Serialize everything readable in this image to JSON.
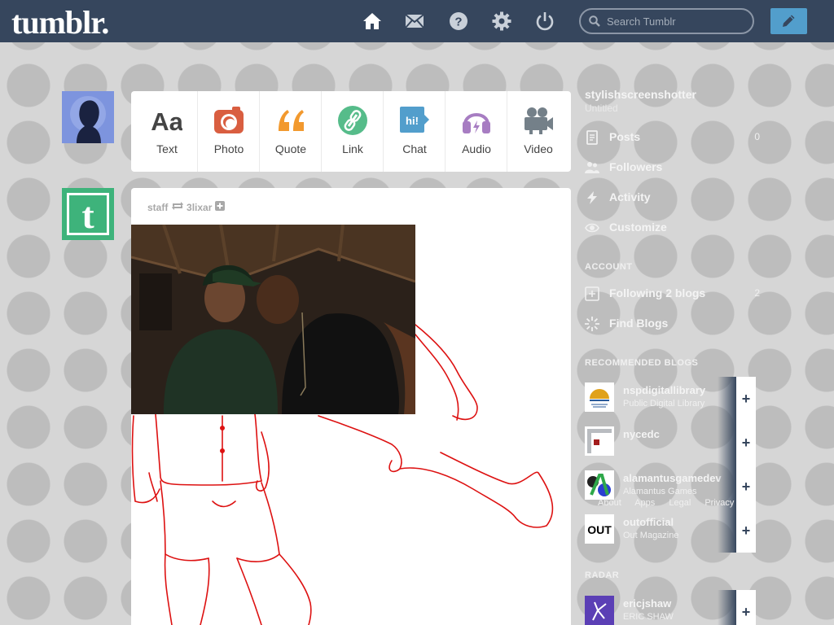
{
  "header": {
    "logo": "tumblr.",
    "search_placeholder": "Search Tumblr",
    "nav": [
      "home-icon",
      "mail-icon",
      "help-icon",
      "settings-icon",
      "power-icon"
    ]
  },
  "post_types": [
    {
      "label": "Text",
      "icon": "text-icon",
      "glyph": "Aa",
      "color": "#444444"
    },
    {
      "label": "Photo",
      "icon": "camera-icon",
      "color": "#d95e40"
    },
    {
      "label": "Quote",
      "icon": "quote-icon",
      "glyph": "“",
      "color": "#f2992e"
    },
    {
      "label": "Link",
      "icon": "link-icon",
      "color": "#56bc8a"
    },
    {
      "label": "Chat",
      "icon": "chat-icon",
      "glyph": "hi!",
      "color": "#529ecc"
    },
    {
      "label": "Audio",
      "icon": "headphones-icon",
      "color": "#a77dc2"
    },
    {
      "label": "Video",
      "icon": "video-camera-icon",
      "color": "#748089"
    }
  ],
  "post": {
    "author": "staff",
    "reblogged_from": "3lixar"
  },
  "sidebar": {
    "blog_name": "stylishscreenshotter",
    "blog_subtitle": "Untitled",
    "items": [
      {
        "label": "Posts",
        "icon": "posts-icon",
        "count": "0"
      },
      {
        "label": "Followers",
        "icon": "followers-icon",
        "count": ""
      },
      {
        "label": "Activity",
        "icon": "activity-icon",
        "count": ""
      },
      {
        "label": "Customize",
        "icon": "eye-icon",
        "count": ""
      }
    ],
    "account_heading": "ACCOUNT",
    "account_items": [
      {
        "label": "Following 2 blogs",
        "icon": "following-icon",
        "count": "2"
      },
      {
        "label": "Find Blogs",
        "icon": "find-blogs-icon",
        "count": ""
      }
    ],
    "recommended_heading": "RECOMMENDED BLOGS",
    "recommended": [
      {
        "name": "nspdigitallibrary",
        "sub": "Public Digital Library"
      },
      {
        "name": "nycedc",
        "sub": ""
      },
      {
        "name": "alamantusgamedev",
        "sub": "Alamantus Games"
      },
      {
        "name": "outofficial",
        "sub": "Out Magazine"
      }
    ],
    "footer_links": [
      "About",
      "Apps",
      "Legal",
      "Privacy"
    ],
    "radar_heading": "RADAR",
    "radar": {
      "name": "ericjshaw",
      "sub": "ERIC SHAW"
    }
  }
}
